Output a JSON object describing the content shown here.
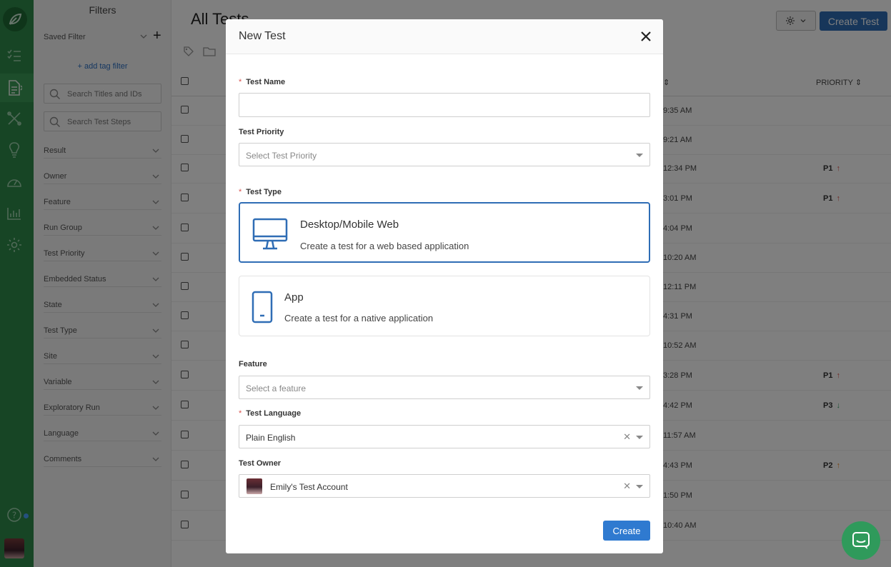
{
  "sidebar": {
    "title": "Filters",
    "saved_filter": "Saved Filter",
    "add_tag_filter": "+ add tag filter",
    "search_titles_placeholder": "Search Titles and IDs",
    "search_steps_placeholder": "Search Test Steps",
    "filters": [
      "Result",
      "Owner",
      "Feature",
      "Run Group",
      "Test Priority",
      "Embedded Status",
      "State",
      "Test Type",
      "Site",
      "Variable",
      "Exploratory Run",
      "Language",
      "Comments"
    ]
  },
  "main": {
    "page_title": "All Tests",
    "create_label": "Create Test",
    "priority_header": "PRIORITY",
    "rows": [
      {
        "time": "9:35 AM",
        "priority": ""
      },
      {
        "time": "9:21 AM",
        "priority": ""
      },
      {
        "time": "12:34 PM",
        "priority": "P1"
      },
      {
        "time": "3:01 PM",
        "priority": "P1"
      },
      {
        "time": "4:04 PM",
        "priority": ""
      },
      {
        "time": "10:20 AM",
        "priority": ""
      },
      {
        "time": "12:11 PM",
        "priority": ""
      },
      {
        "time": "4:31 PM",
        "priority": ""
      },
      {
        "time": "10:52 AM",
        "priority": ""
      },
      {
        "time": "3:28 PM",
        "priority": "P1"
      },
      {
        "time": "4:42 PM",
        "priority": "P3"
      },
      {
        "time": "11:57 AM",
        "priority": ""
      },
      {
        "time": "4:43 PM",
        "priority": "P2"
      },
      {
        "time": "1:50 PM",
        "priority": ""
      },
      {
        "time": "10:40 AM",
        "priority": ""
      }
    ]
  },
  "modal": {
    "title": "New Test",
    "test_name_label": "Test Name",
    "test_name_value": "",
    "priority_label": "Test Priority",
    "priority_placeholder": "Select Test Priority",
    "type_label": "Test Type",
    "types": [
      {
        "name": "Desktop/Mobile Web",
        "desc": "Create a test for a web based application",
        "selected": true
      },
      {
        "name": "App",
        "desc": "Create a test for a native application",
        "selected": false
      }
    ],
    "feature_label": "Feature",
    "feature_placeholder": "Select a feature",
    "language_label": "Test Language",
    "language_value": "Plain English",
    "owner_label": "Test Owner",
    "owner_value": "Emily's Test Account",
    "create_button": "Create"
  },
  "colors": {
    "brand_green": "#2f8a4a",
    "primary_blue": "#2f6db5",
    "required_red": "#d9534f",
    "priority_up_red": "#e0534a",
    "priority_down_green": "#3aa56a",
    "priority_up_orange": "#f08a24"
  }
}
